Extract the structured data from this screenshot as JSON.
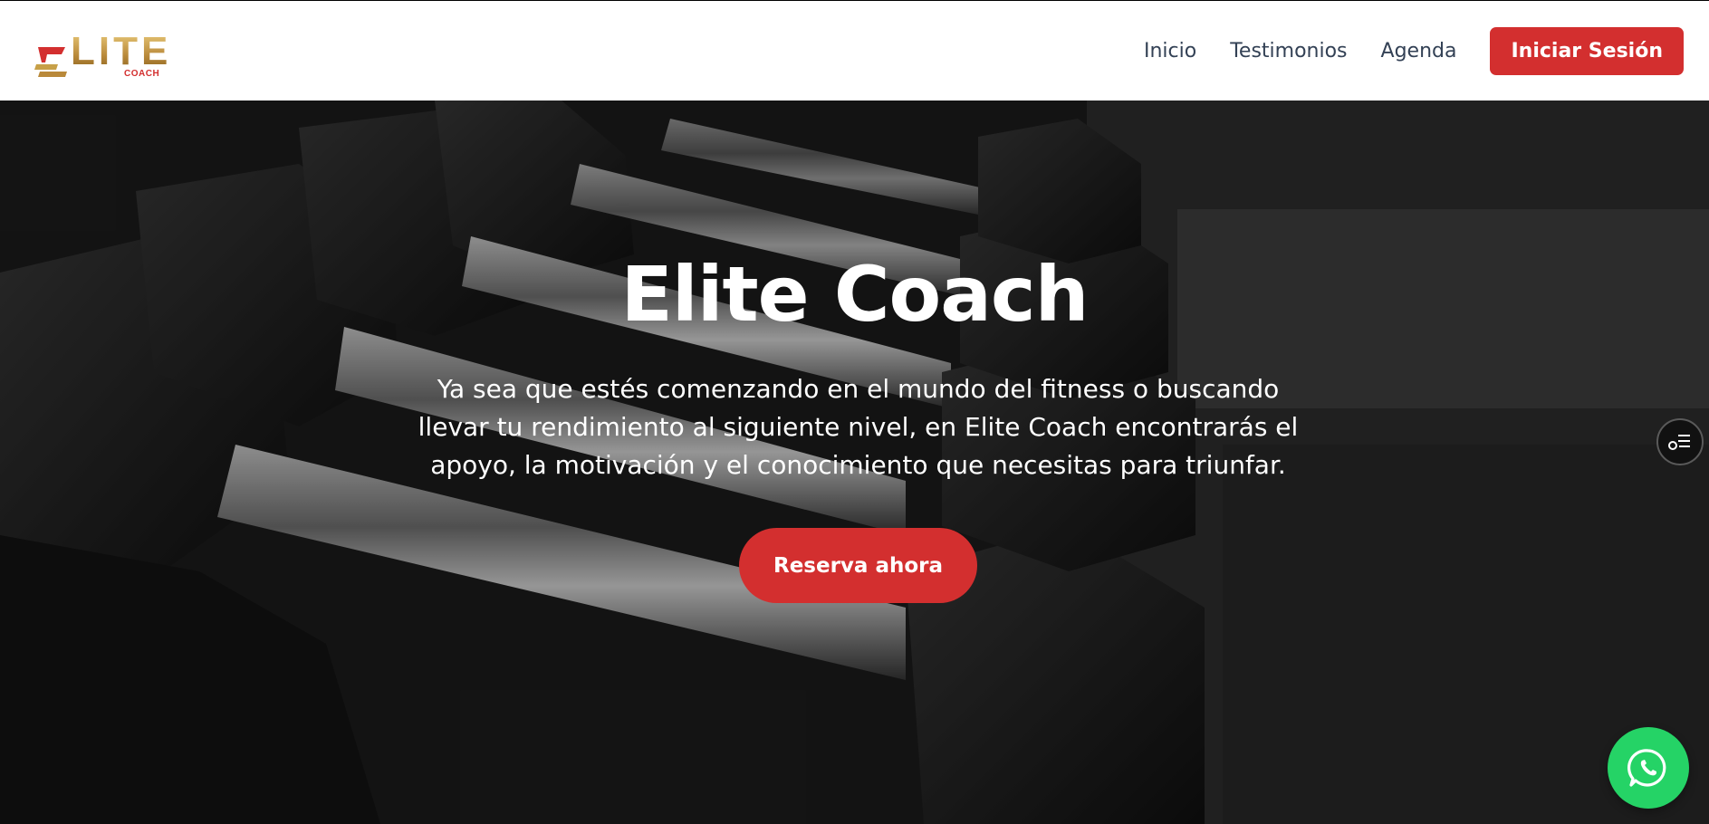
{
  "brand": {
    "logo_word": "LITE",
    "logo_sub": "COACH",
    "logo_colors": {
      "gold": "#c7a048",
      "red": "#d32f2f"
    }
  },
  "nav": {
    "items": [
      {
        "label": "Inicio"
      },
      {
        "label": "Testimonios"
      },
      {
        "label": "Agenda"
      }
    ],
    "login_label": "Iniciar Sesión"
  },
  "hero": {
    "title": "Elite Coach",
    "description": "Ya sea que estés comenzando en el mundo del fitness o buscando llevar tu rendimiento al siguiente nivel, en Elite Coach encontrarás el apoyo, la motivación y el conocimiento que necesitas para triunfar.",
    "cta_label": "Reserva ahora",
    "background_image": "dumbbell-rack-photo"
  },
  "floating": {
    "side_toggle_icon": "accessibility-menu-icon",
    "whatsapp_icon": "whatsapp-icon"
  },
  "colors": {
    "accent": "#d32f2f",
    "nav_text": "#334155",
    "whatsapp": "#25d366"
  }
}
